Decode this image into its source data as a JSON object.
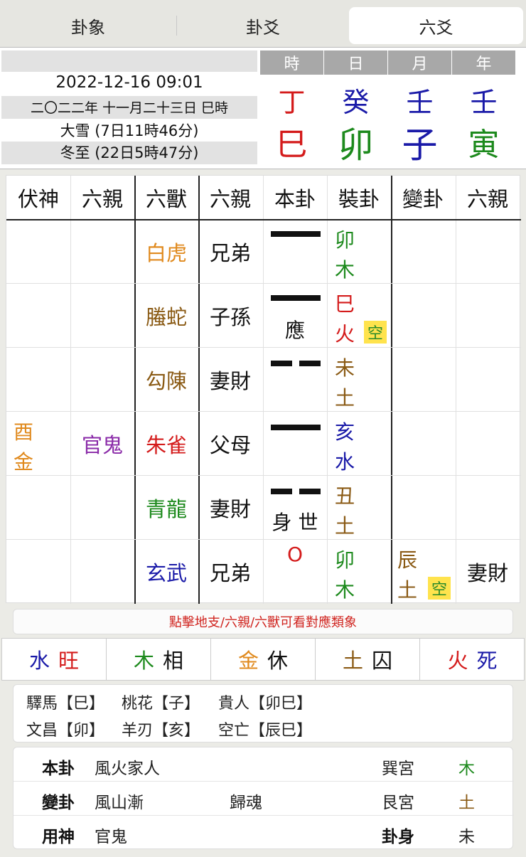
{
  "tabs": [
    "卦象",
    "卦爻",
    "六爻"
  ],
  "header": {
    "datetime": "2022-12-16 09:01",
    "lunar": "二〇二二年 十一月二十三日 巳時",
    "term1": "大雪 (7日11時46分)",
    "term2": "冬至 (22日5時47分)",
    "pillars": [
      {
        "label": "時",
        "stem": "丁",
        "branch": "巳",
        "stem_color": "#d41b1b",
        "branch_color": "#d41b1b"
      },
      {
        "label": "日",
        "stem": "癸",
        "branch": "卯",
        "stem_color": "#1a1aa8",
        "branch_color": "#1d8a1d"
      },
      {
        "label": "月",
        "stem": "壬",
        "branch": "子",
        "stem_color": "#1a1aa8",
        "branch_color": "#1a1aa8"
      },
      {
        "label": "年",
        "stem": "壬",
        "branch": "寅",
        "stem_color": "#1a1aa8",
        "branch_color": "#1d8a1d"
      }
    ]
  },
  "table": {
    "headers": [
      "伏神",
      "六親",
      "六獸",
      "六親",
      "本卦",
      "裝卦",
      "變卦",
      "六親"
    ],
    "rows": [
      {
        "beast": "白虎",
        "beast_color": "#e08a1e",
        "relative": "兄弟",
        "line": "yang",
        "mark": "",
        "branch": [
          "卯",
          "木"
        ],
        "branch_color": "#1d8a1d",
        "kong": false
      },
      {
        "beast": "螣蛇",
        "beast_color": "#8a5a14",
        "relative": "子孫",
        "line": "yang",
        "mark": "應",
        "branch": [
          "巳",
          "火"
        ],
        "branch_color": "#d41b1b",
        "kong": true
      },
      {
        "beast": "勾陳",
        "beast_color": "#8a5a14",
        "relative": "妻財",
        "line": "yin",
        "mark": "",
        "branch": [
          "未",
          "土"
        ],
        "branch_color": "#8a5a14",
        "kong": false
      },
      {
        "beast": "朱雀",
        "beast_color": "#d41b1b",
        "relative": "父母",
        "line": "yang",
        "mark": "",
        "branch": [
          "亥",
          "水"
        ],
        "branch_color": "#1a1aa8",
        "kong": false,
        "hidden": [
          "酉",
          "金"
        ],
        "hidden_color": "#e08a1e",
        "hidden_relative": "官鬼",
        "hidden_relative_color": "#8a2aa8"
      },
      {
        "beast": "青龍",
        "beast_color": "#1d8a1d",
        "relative": "妻財",
        "line": "yin",
        "mark": "身 世",
        "branch": [
          "丑",
          "土"
        ],
        "branch_color": "#8a5a14",
        "kong": false
      },
      {
        "beast": "玄武",
        "beast_color": "#1a1aa8",
        "relative": "兄弟",
        "line": "moving",
        "mark": "O",
        "branch": [
          "卯",
          "木"
        ],
        "branch_color": "#1d8a1d",
        "kong": false,
        "changed": [
          "辰",
          "土"
        ],
        "changed_color": "#8a5a14",
        "changed_kong": true,
        "changed_relative": "妻財"
      }
    ],
    "kong_label": "空"
  },
  "hint": "點擊地支/六親/六獸可看對應類象",
  "seasons": [
    {
      "element": "水",
      "state": "旺",
      "color": "#1a1aa8",
      "state_color": "#d41b1b"
    },
    {
      "element": "木",
      "state": "相",
      "color": "#1d8a1d",
      "state_color": "#111"
    },
    {
      "element": "金",
      "state": "休",
      "color": "#e08a1e",
      "state_color": "#111"
    },
    {
      "element": "土",
      "state": "囚",
      "color": "#8a5a14",
      "state_color": "#111"
    },
    {
      "element": "火",
      "state": "死",
      "color": "#d41b1b",
      "state_color": "#1a1aa8"
    }
  ],
  "spirits": [
    "驛馬【巳】",
    "桃花【子】",
    "貴人【卯巳】",
    "文昌【卯】",
    "羊刃【亥】",
    "空亡【辰巳】"
  ],
  "summary": {
    "ben_label": "本卦",
    "ben_name": "風火家人",
    "ben_palace": "巽宮",
    "ben_element": "木",
    "ben_element_color": "#1d8a1d",
    "bian_label": "變卦",
    "bian_name": "風山漸",
    "bian_type": "歸魂",
    "bian_palace": "艮宮",
    "bian_element": "土",
    "bian_element_color": "#8a5a14",
    "yong_label": "用神",
    "yong_value": "官鬼",
    "body_label": "卦身",
    "body_value": "未"
  }
}
